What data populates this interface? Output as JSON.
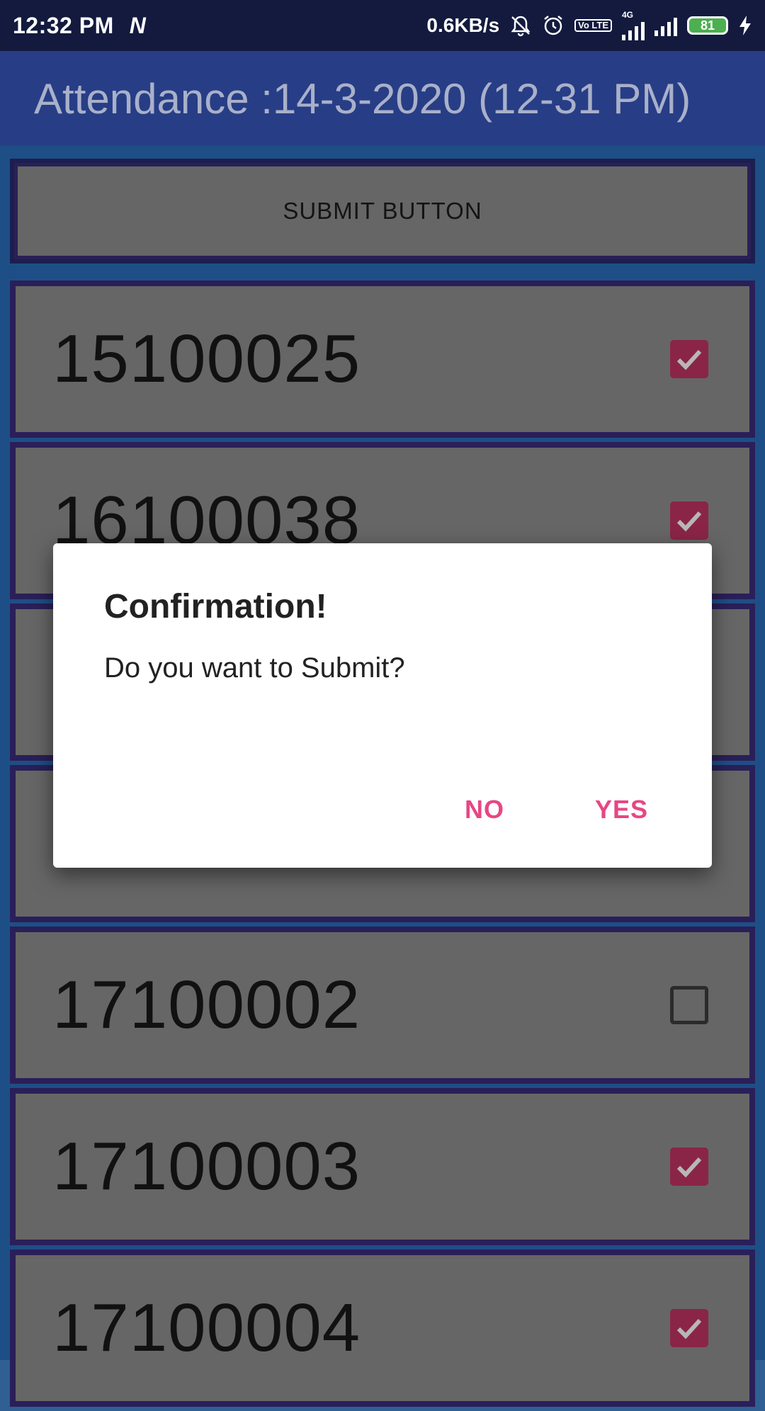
{
  "status_bar": {
    "time": "12:32 PM",
    "app_icon": "N",
    "speed": "0.6KB/s",
    "network": "4G",
    "volte": "Vo LTE",
    "battery": "81"
  },
  "app_bar": {
    "title": "Attendance :14-3-2020 (12-31 PM)"
  },
  "submit_label": "SUBMIT BUTTON",
  "rows": [
    {
      "id": "15100025",
      "checked": true
    },
    {
      "id": "16100038",
      "checked": true
    },
    {
      "id": "",
      "checked": true
    },
    {
      "id": "",
      "checked": true
    },
    {
      "id": "17100002",
      "checked": false
    },
    {
      "id": "17100003",
      "checked": true
    },
    {
      "id": "17100004",
      "checked": true
    }
  ],
  "dialog": {
    "title": "Confirmation!",
    "message": "Do you want to Submit?",
    "no_label": "NO",
    "yes_label": "YES"
  },
  "colors": {
    "accent": "#e64783",
    "checkbox_checked": "#8a2547"
  }
}
